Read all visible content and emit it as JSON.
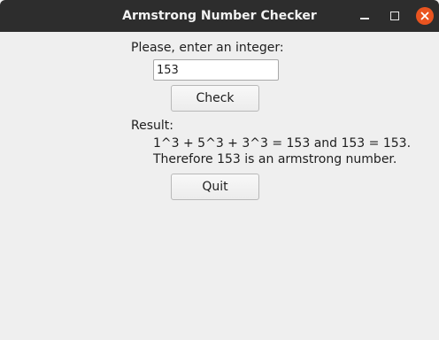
{
  "window": {
    "title": "Armstrong Number Checker"
  },
  "form": {
    "prompt_label": "Please, enter an integer:",
    "input_value": "153",
    "check_label": "Check",
    "result_label": "Result:",
    "result_line_1": "1^3 + 5^3 + 3^3 = 153 and 153 = 153.",
    "result_line_2": "Therefore 153 is an armstrong number.",
    "quit_label": "Quit"
  },
  "icons": {
    "minimize": "minimize-icon",
    "maximize": "maximize-icon",
    "close": "close-icon"
  },
  "colors": {
    "titlebar": "#2d2d2d",
    "close_button": "#e95420",
    "background": "#efefef"
  }
}
